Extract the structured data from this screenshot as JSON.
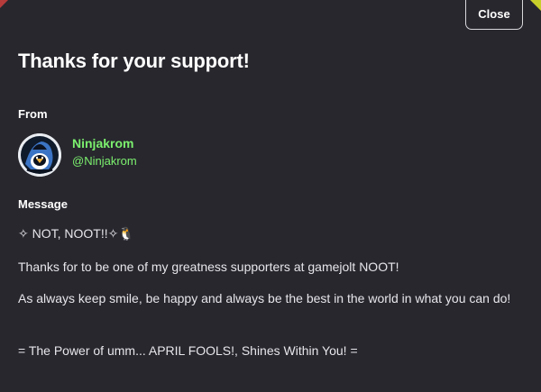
{
  "modal": {
    "close_label": "Close",
    "title": "Thanks for your support!",
    "from_label": "From",
    "message_label": "Message"
  },
  "sender": {
    "display_name": "Ninjakrom",
    "username": "@Ninjakrom",
    "name_color": "#7cf06e"
  },
  "message": {
    "lines": [
      "✧ NOT, NOOT!!✧🐧",
      "Thanks for to be one of my greatness supporters at gamejolt NOOT!",
      "As always keep smile, be happy and always be the best in the world in what you can do!",
      "= The Power of umm... APRIL FOOLS!, Shines Within You! ="
    ]
  },
  "colors": {
    "background": "#28272e",
    "text": "#ffffff",
    "accent": "#7cf06e"
  }
}
